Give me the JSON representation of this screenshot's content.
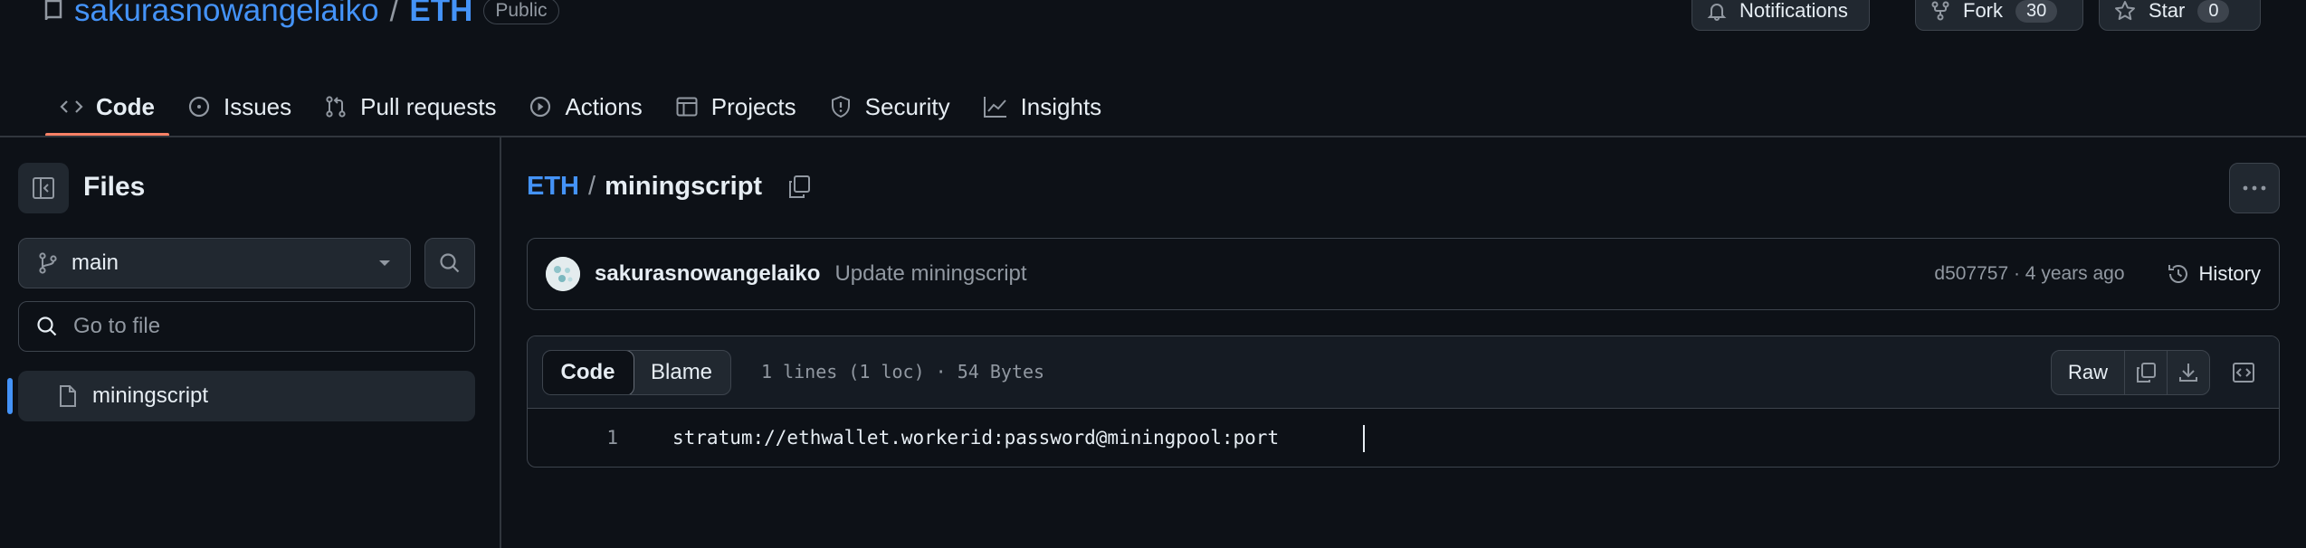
{
  "repo": {
    "owner": "sakurasnowangelaiko",
    "separator": "/",
    "name": "ETH",
    "visibility": "Public"
  },
  "header_actions": {
    "notifications": "Notifications",
    "fork": {
      "label": "Fork",
      "count": "30"
    },
    "star": {
      "label": "Star",
      "count": "0"
    }
  },
  "tabs": [
    {
      "label": "Code",
      "icon": "code-icon",
      "active": true
    },
    {
      "label": "Issues",
      "icon": "issue-icon"
    },
    {
      "label": "Pull requests",
      "icon": "pull-request-icon"
    },
    {
      "label": "Actions",
      "icon": "play-icon"
    },
    {
      "label": "Projects",
      "icon": "table-icon"
    },
    {
      "label": "Security",
      "icon": "shield-icon"
    },
    {
      "label": "Insights",
      "icon": "graph-icon"
    }
  ],
  "sidebar": {
    "title": "Files",
    "branch": "main",
    "goto_placeholder": "Go to file",
    "files": [
      {
        "name": "miningscript",
        "selected": true
      }
    ]
  },
  "breadcrumb": {
    "root": "ETH",
    "separator": "/",
    "file": "miningscript"
  },
  "commit": {
    "author": "sakurasnowangelaiko",
    "message": "Update miningscript",
    "meta": "d507757 · 4 years ago",
    "history_label": "History"
  },
  "code_view": {
    "tab_code": "Code",
    "tab_blame": "Blame",
    "info": "1 lines (1 loc) · 54 Bytes",
    "raw_label": "Raw",
    "lines": [
      {
        "number": "1",
        "text": "stratum://ethwallet.workerid:password@miningpool:port"
      }
    ]
  },
  "colors": {
    "background": "#0d1117",
    "link": "#4493f8",
    "active_tab": "#f78166",
    "border": "#3d444d"
  }
}
